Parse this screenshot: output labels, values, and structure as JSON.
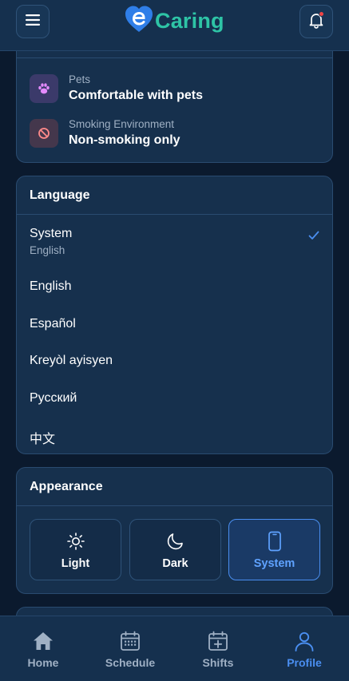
{
  "header": {
    "brand": "Caring",
    "menu_icon": "hamburger-menu-icon",
    "bell_icon": "bell-icon",
    "notification_dot_color": "#ef4444"
  },
  "preferences": {
    "items": [
      {
        "icon": "paw-icon",
        "label": "Pets",
        "value": "Comfortable with pets"
      },
      {
        "icon": "no-smoking-icon",
        "label": "Smoking Environment",
        "value": "Non-smoking only"
      }
    ]
  },
  "language": {
    "title": "Language",
    "selected_index": 0,
    "options": [
      {
        "label": "System",
        "sublabel": "English"
      },
      {
        "label": "English"
      },
      {
        "label": "Español"
      },
      {
        "label": "Kreyòl ayisyen"
      },
      {
        "label": "Русский"
      },
      {
        "label": "中文"
      }
    ]
  },
  "appearance": {
    "title": "Appearance",
    "selected": "System",
    "modes": [
      {
        "label": "Light",
        "icon": "sun-icon"
      },
      {
        "label": "Dark",
        "icon": "moon-icon"
      },
      {
        "label": "System",
        "icon": "phone-icon"
      }
    ]
  },
  "nav": {
    "active": "Profile",
    "items": [
      {
        "label": "Home",
        "icon": "home-icon"
      },
      {
        "label": "Schedule",
        "icon": "calendar-icon"
      },
      {
        "label": "Shifts",
        "icon": "calendar-plus-icon"
      },
      {
        "label": "Profile",
        "icon": "user-icon"
      }
    ]
  },
  "colors": {
    "background": "#0b1a2e",
    "card": "#16304d",
    "brand": "#2ec4a6",
    "accent": "#4a8ef0"
  }
}
